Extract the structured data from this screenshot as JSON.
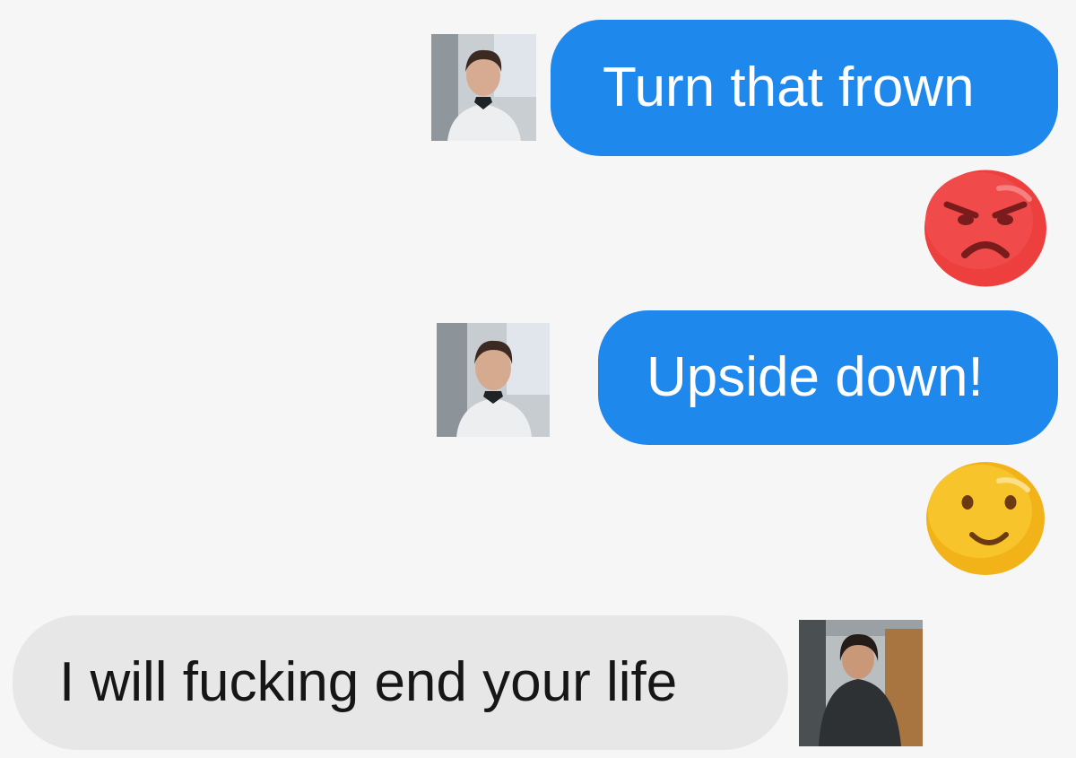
{
  "conversation": {
    "messages": [
      {
        "sender": "outgoing",
        "text": "Turn that frown",
        "avatar": "man-portrait"
      },
      {
        "sender": "outgoing",
        "reaction": "angry-face-emoji"
      },
      {
        "sender": "outgoing",
        "text": "Upside down!",
        "avatar": "man-portrait"
      },
      {
        "sender": "outgoing",
        "reaction": "smiling-face-emoji"
      },
      {
        "sender": "incoming",
        "text": "I will fucking end your life",
        "avatar": "woman-portrait"
      }
    ]
  },
  "colors": {
    "background": "#f6f6f6",
    "outgoing_bubble": "#1e88ec",
    "incoming_bubble": "#e7e7e7",
    "angry_emoji": "#ee3f3f",
    "smile_emoji": "#f7c52b"
  }
}
